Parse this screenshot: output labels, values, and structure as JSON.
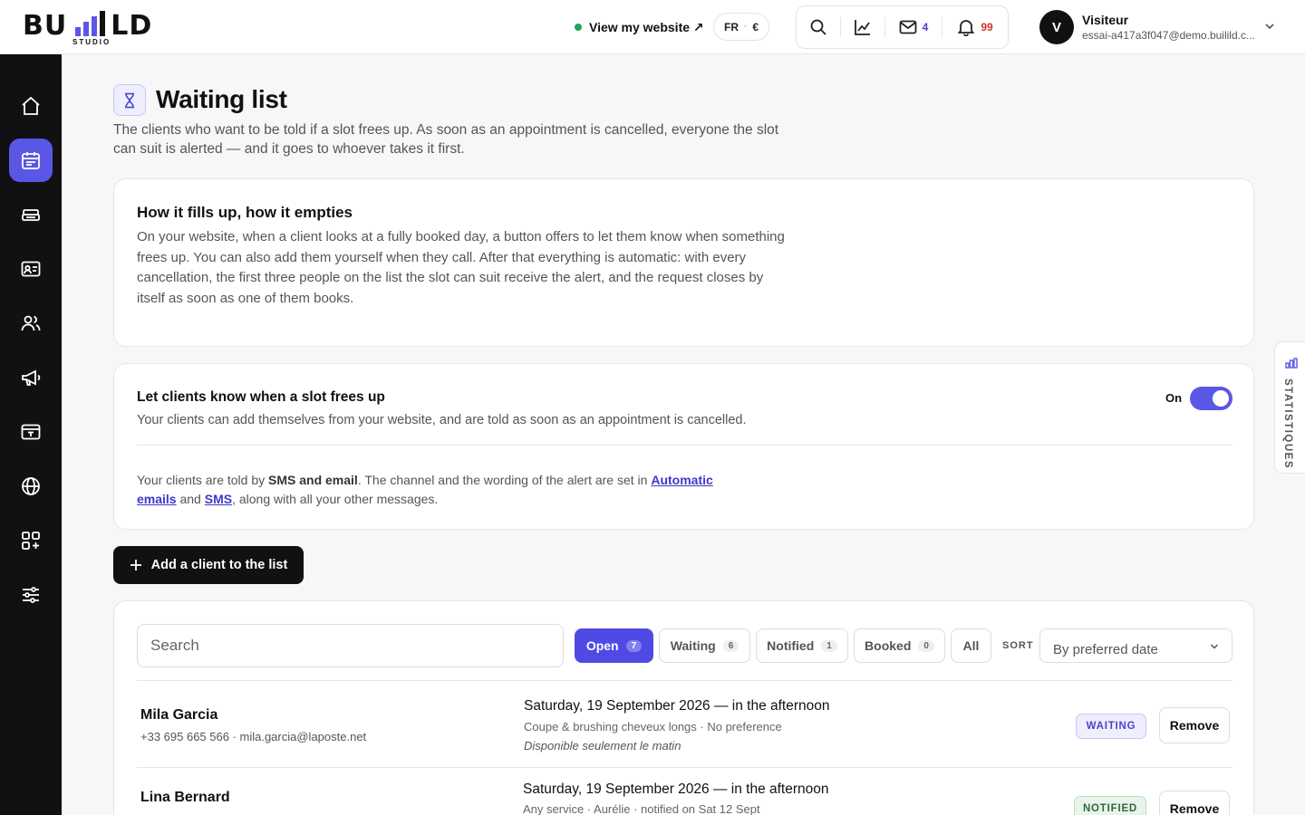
{
  "brand": {
    "name": "BUILLD",
    "sub": "STUDIO"
  },
  "header": {
    "view_site": "View my website ↗",
    "lang": "FR",
    "currency": "€",
    "mail_count": "4",
    "notif_count": "99",
    "user_initial": "V",
    "user_name": "Visiteur",
    "user_email": "essai-a417a3f047@demo.builild.c..."
  },
  "page": {
    "title": "Waiting list",
    "description": "The clients who want to be told if a slot frees up. As soon as an appointment is cancelled, everyone the slot can suit is alerted — and it goes to whoever takes it first."
  },
  "how_it_works": {
    "title": "How it fills up, how it empties",
    "body": "On your website, when a client looks at a fully booked day, a button offers to let them know when something frees up. You can also add them yourself when they call. After that everything is automatic: with every cancellation, the first three people on the list the slot can suit receive the alert, and the request closes by itself as soon as one of them books."
  },
  "settings": {
    "title": "Let clients know when a slot frees up",
    "subtitle": "Your clients can add themselves from your website, and are told as soon as an appointment is cancelled.",
    "toggle_label": "On",
    "note_prefix": "Your clients are told by ",
    "note_channels": "SMS and email",
    "note_mid": ". The channel and the wording of the alert are set in ",
    "note_link1": "Automatic emails",
    "note_and": " and ",
    "note_link2": "SMS",
    "note_suffix": ", along with all your other messages."
  },
  "add_button": "Add a client to the list",
  "list": {
    "search_placeholder": "Search",
    "filters": [
      {
        "label": "Open",
        "count": "7"
      },
      {
        "label": "Waiting",
        "count": "6"
      },
      {
        "label": "Notified",
        "count": "1"
      },
      {
        "label": "Booked",
        "count": "0"
      },
      {
        "label": "All",
        "count": ""
      }
    ],
    "sort_label": "SORT",
    "sort_value": "By preferred date",
    "rows": [
      {
        "name": "Mila Garcia",
        "contact": "+33 695 665 566 · mila.garcia@laposte.net",
        "date": "Saturday, 19 September 2026 — in the afternoon",
        "detail": "Coupe & brushing cheveux longs · No preference",
        "note": "Disponible seulement le matin",
        "status": "WAITING",
        "action": "Remove"
      },
      {
        "name": "Lina Bernard",
        "contact": "",
        "date": "Saturday, 19 September 2026 — in the afternoon",
        "detail": "Any service · Aurélie · notified on Sat 12 Sept",
        "note": "",
        "status": "NOTIFIED",
        "action": "Remove"
      }
    ]
  },
  "stats_tab": "STATISTIQUES",
  "colors": {
    "accent": "#5b57e6",
    "sidebar": "#111113",
    "success": "#22a55a",
    "danger": "#d0342c"
  }
}
